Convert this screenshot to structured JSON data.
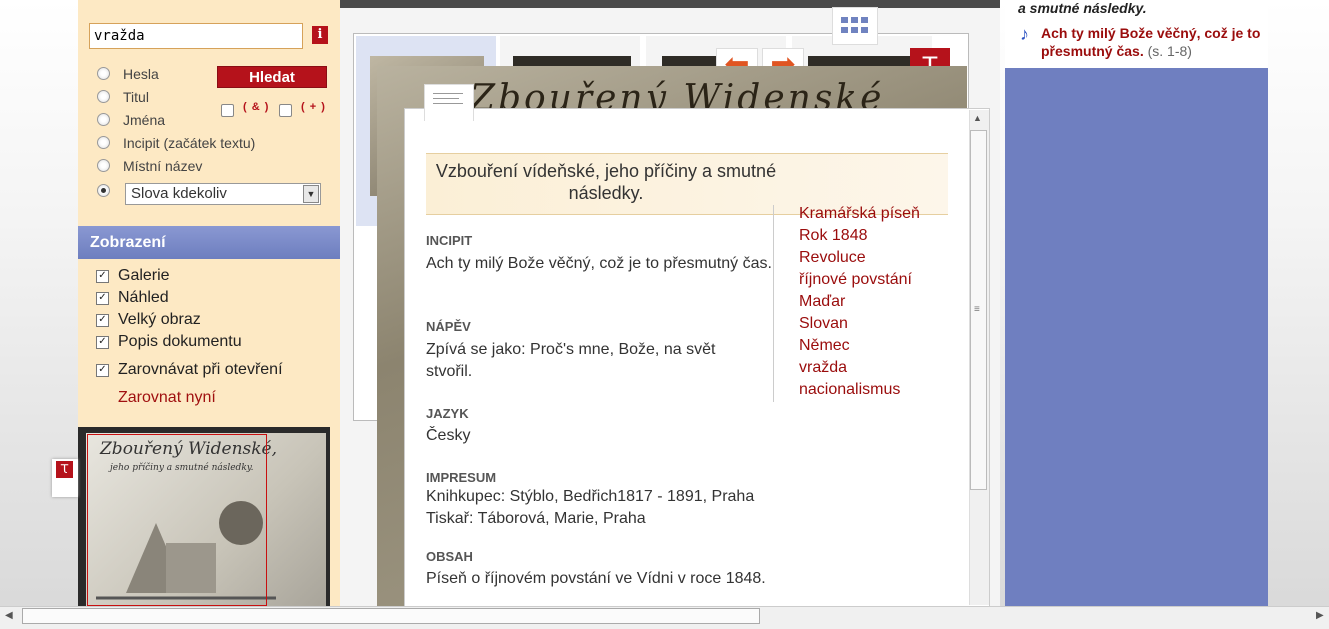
{
  "search": {
    "query": "vražda",
    "info_label": "i",
    "submit_label": "Hledat",
    "options": [
      "Hesla",
      "Titul",
      "Jména",
      "Incipit (začátek textu)",
      "Místní název"
    ],
    "operators": [
      "( & )",
      "( + )"
    ],
    "select_value": "Slova kdekoliv"
  },
  "display": {
    "header": "Zobrazení",
    "checkboxes": [
      "Galerie",
      "Náhled",
      "Velký obraz",
      "Popis dokumentu",
      "Zarovnávat při otevření"
    ],
    "align_now": "Zarovnat nyní"
  },
  "thumbnail": {
    "title_text": "Zbouřený Widenské,",
    "subtitle_text": "jeho příčiny a smutné následky."
  },
  "gallery": {
    "grid_icon": "grid-icon",
    "prev_icon": "arrow-left-icon",
    "next_icon": "arrow-right-icon",
    "logo_glyph": "Ꚍ",
    "scan_title": "Zbouřený Widenské"
  },
  "document": {
    "title": "Vzbouření vídeňské, jeho příčiny a smutné následky.",
    "sections": [
      {
        "heading": "INCIPIT",
        "lines": [
          "Ach ty milý Bože věčný, což je to přesmutný čas."
        ]
      },
      {
        "heading": "NÁPĚV",
        "lines": [
          "Zpívá se jako: Proč's mne, Bože, na svět stvořil."
        ]
      },
      {
        "heading": "JAZYK",
        "lines": [
          "Česky"
        ]
      },
      {
        "heading": "IMPRESUM",
        "lines": [
          "Knihkupec: Stýblo, Bedřich1817 - 1891, Praha",
          "Tiskař: Táborová, Marie, Praha"
        ]
      },
      {
        "heading": "OBSAH",
        "lines": [
          "Píseň o říjnovém povstání ve Vídni v roce 1848."
        ]
      }
    ],
    "keywords": [
      "Kramářská píseň",
      "Rok 1848",
      "Revoluce",
      "říjnové povstání",
      "Maďar",
      "Slovan",
      "Němec",
      "vražda",
      "nacionalismus"
    ]
  },
  "right_panel": {
    "header": "a smutné následky.",
    "link_text": "Ach ty milý Bože věčný, což je to přesmutný čas.",
    "page_ref": "(s. 1-8)"
  },
  "colors": {
    "accent_red": "#b5121b",
    "panel_beige": "#fde9c4",
    "nav_blue": "#6f7fc0"
  }
}
